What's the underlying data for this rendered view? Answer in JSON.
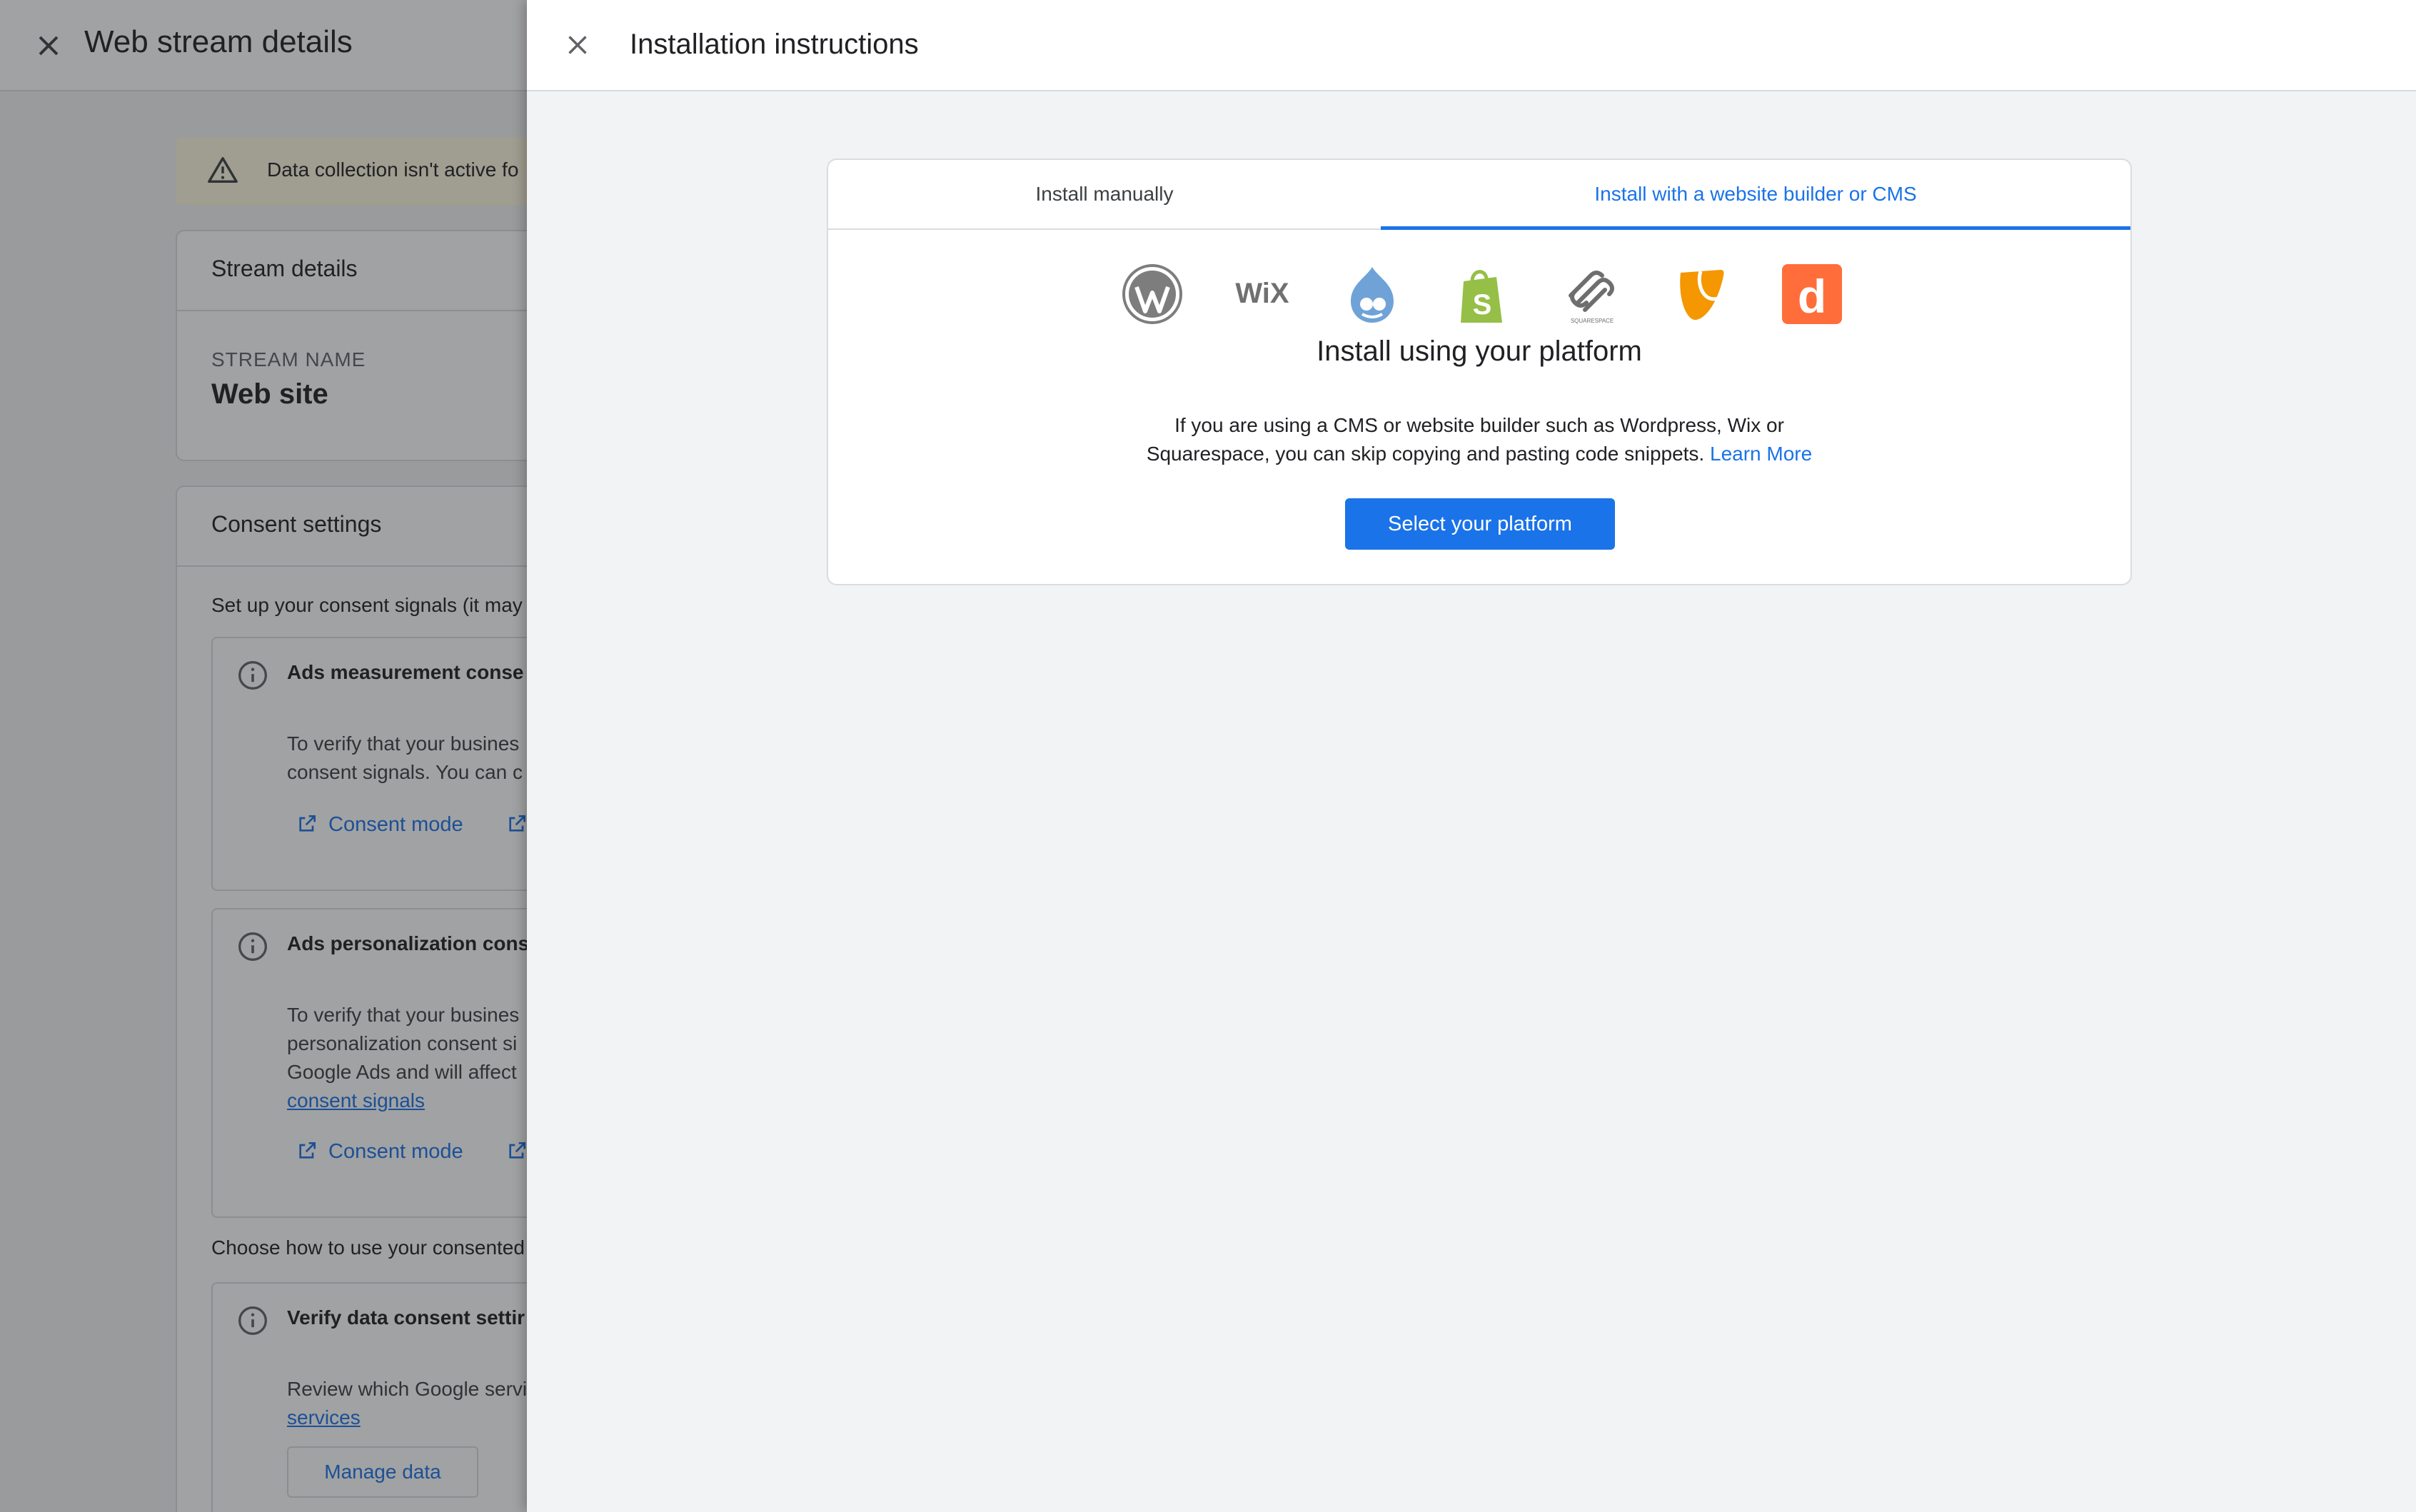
{
  "background": {
    "title": "Web stream details",
    "alert_text": "Data collection isn't active fo",
    "stream_details": {
      "heading": "Stream details",
      "name_label": "STREAM NAME",
      "name_value": "Web site"
    },
    "consent": {
      "heading": "Consent settings",
      "intro": "Set up your consent signals (it may",
      "ads_measurement": {
        "title": "Ads measurement conse",
        "body_line1": "To verify that your busines",
        "body_line2": "consent signals. You can c",
        "link_label": "Consent mode"
      },
      "ads_personalization": {
        "title": "Ads personalization cons",
        "body_line1": "To verify that your busines",
        "body_line2": "personalization consent si",
        "body_line3": "Google Ads and will affect",
        "body_link": "consent signals",
        "link_label": "Consent mode"
      },
      "choose_text": "Choose how to use your consented",
      "verify": {
        "title": "Verify data consent settir",
        "body_line1": "Review which Google servi",
        "body_link": "services",
        "button_label": "Manage data"
      }
    }
  },
  "drawer": {
    "title": "Installation instructions",
    "tabs": [
      {
        "label": "Install manually",
        "active": false
      },
      {
        "label": "Install with a website builder or CMS",
        "active": true
      }
    ],
    "platform_logos": [
      "wordpress-icon",
      "wix-icon",
      "drupal-icon",
      "shopify-icon",
      "squarespace-icon",
      "typo3-icon",
      "duda-icon"
    ],
    "wix_text": "WiX",
    "squarespace_text": "SQUARESPACE",
    "duda_text": "d",
    "heading": "Install using your platform",
    "description_line1": "If you are using a CMS or website builder such as Wordpress, Wix or",
    "description_line2": "Squarespace, you can skip copying and pasting code snippets.",
    "learn_more": "Learn More",
    "button_label": "Select your platform"
  },
  "colors": {
    "accent": "#1a73e8",
    "alert_bg": "#fef7e0",
    "wordpress": "#7d7d7d",
    "drupal": "#6fa3d8",
    "shopify": "#95bf47",
    "typo3": "#f49700",
    "duda": "#ff6e3a"
  }
}
